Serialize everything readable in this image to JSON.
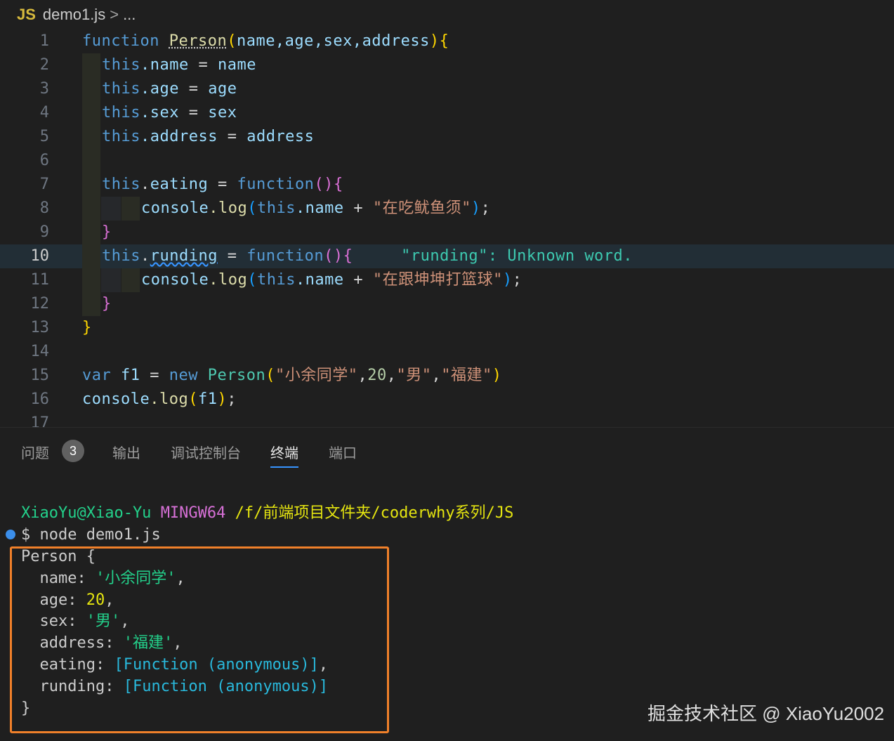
{
  "breadcrumb": {
    "lang_badge": "JS",
    "file": "demo1.js",
    "separator": ">",
    "more": "..."
  },
  "editor": {
    "line_numbers": [
      "1",
      "2",
      "3",
      "4",
      "5",
      "6",
      "7",
      "8",
      "9",
      "10",
      "11",
      "12",
      "13",
      "14",
      "15",
      "16",
      "17"
    ],
    "lines": {
      "l1": {
        "kw": "function",
        "name": "Person",
        "open": "(",
        "params": "name,age,sex,address",
        "close": ")",
        "brace": "{"
      },
      "l2": {
        "this": "this",
        "prop": ".name",
        "eq": "=",
        "val": "name"
      },
      "l3": {
        "this": "this",
        "prop": ".age",
        "eq": "=",
        "val": "age"
      },
      "l4": {
        "this": "this",
        "prop": ".sex",
        "eq": "=",
        "val": "sex"
      },
      "l5": {
        "this": "this",
        "prop": ".address",
        "eq": "=",
        "val": "address"
      },
      "l7": {
        "this": "this",
        "prop_dot": ".",
        "prop": "eating",
        "eq": "=",
        "kw": "function",
        "parens": "()",
        "brace": "{"
      },
      "l8": {
        "obj": "console",
        "method": ".log",
        "open": "(",
        "this": "this",
        "prop": ".name",
        "plus": "+",
        "str": "\"在吃鱿鱼须\"",
        "close": ")",
        "semi": ";"
      },
      "l9": {
        "brace": "}"
      },
      "l10": {
        "this": "this",
        "prop_dot": ".",
        "prop": "runding",
        "eq": "=",
        "kw": "function",
        "parens": "()",
        "brace": "{",
        "hint": "\"runding\": Unknown word."
      },
      "l11": {
        "obj": "console",
        "method": ".log",
        "open": "(",
        "this": "this",
        "prop": ".name",
        "plus": "+",
        "str": "\"在跟坤坤打篮球\"",
        "close": ")",
        "semi": ";"
      },
      "l12": {
        "brace": "}"
      },
      "l13": {
        "brace": "}"
      },
      "l15": {
        "kw": "var",
        "name": "f1",
        "eq": "=",
        "new": "new",
        "cls": "Person",
        "open": "(",
        "a1": "\"小余同学\"",
        "c1": ",",
        "a2": "20",
        "c2": ",",
        "a3": "\"男\"",
        "c3": ",",
        "a4": "\"福建\"",
        "close": ")"
      },
      "l16": {
        "obj": "console",
        "method": ".log",
        "open": "(",
        "arg": "f1",
        "close": ")",
        "semi": ";"
      }
    }
  },
  "panel": {
    "tabs": [
      {
        "label": "问题",
        "badge": "3"
      },
      {
        "label": "输出"
      },
      {
        "label": "调试控制台"
      },
      {
        "label": "终端"
      },
      {
        "label": "端口"
      }
    ]
  },
  "terminal": {
    "user": "XiaoYu@Xiao-Yu",
    "system": "MINGW64",
    "path": "/f/前端项目文件夹/coderwhy系列/JS",
    "prompt": "$",
    "command": "node demo1.js",
    "output": {
      "head": "Person {",
      "name_key": "name:",
      "name_val": "'小余同学'",
      "age_key": "age:",
      "age_val": "20",
      "sex_key": "sex:",
      "sex_val": "'男'",
      "address_key": "address:",
      "address_val": "'福建'",
      "eating_key": "eating:",
      "eating_val": "[Function (anonymous)]",
      "runding_key": "runding:",
      "runding_val": "[Function (anonymous)]",
      "comma": ",",
      "tail": "}"
    }
  },
  "watermark": "掘金技术社区 @ XiaoYu2002",
  "colors": {
    "accent": "#3794ff",
    "highlight_box": "#f0802a",
    "background": "#1f1f1f"
  }
}
